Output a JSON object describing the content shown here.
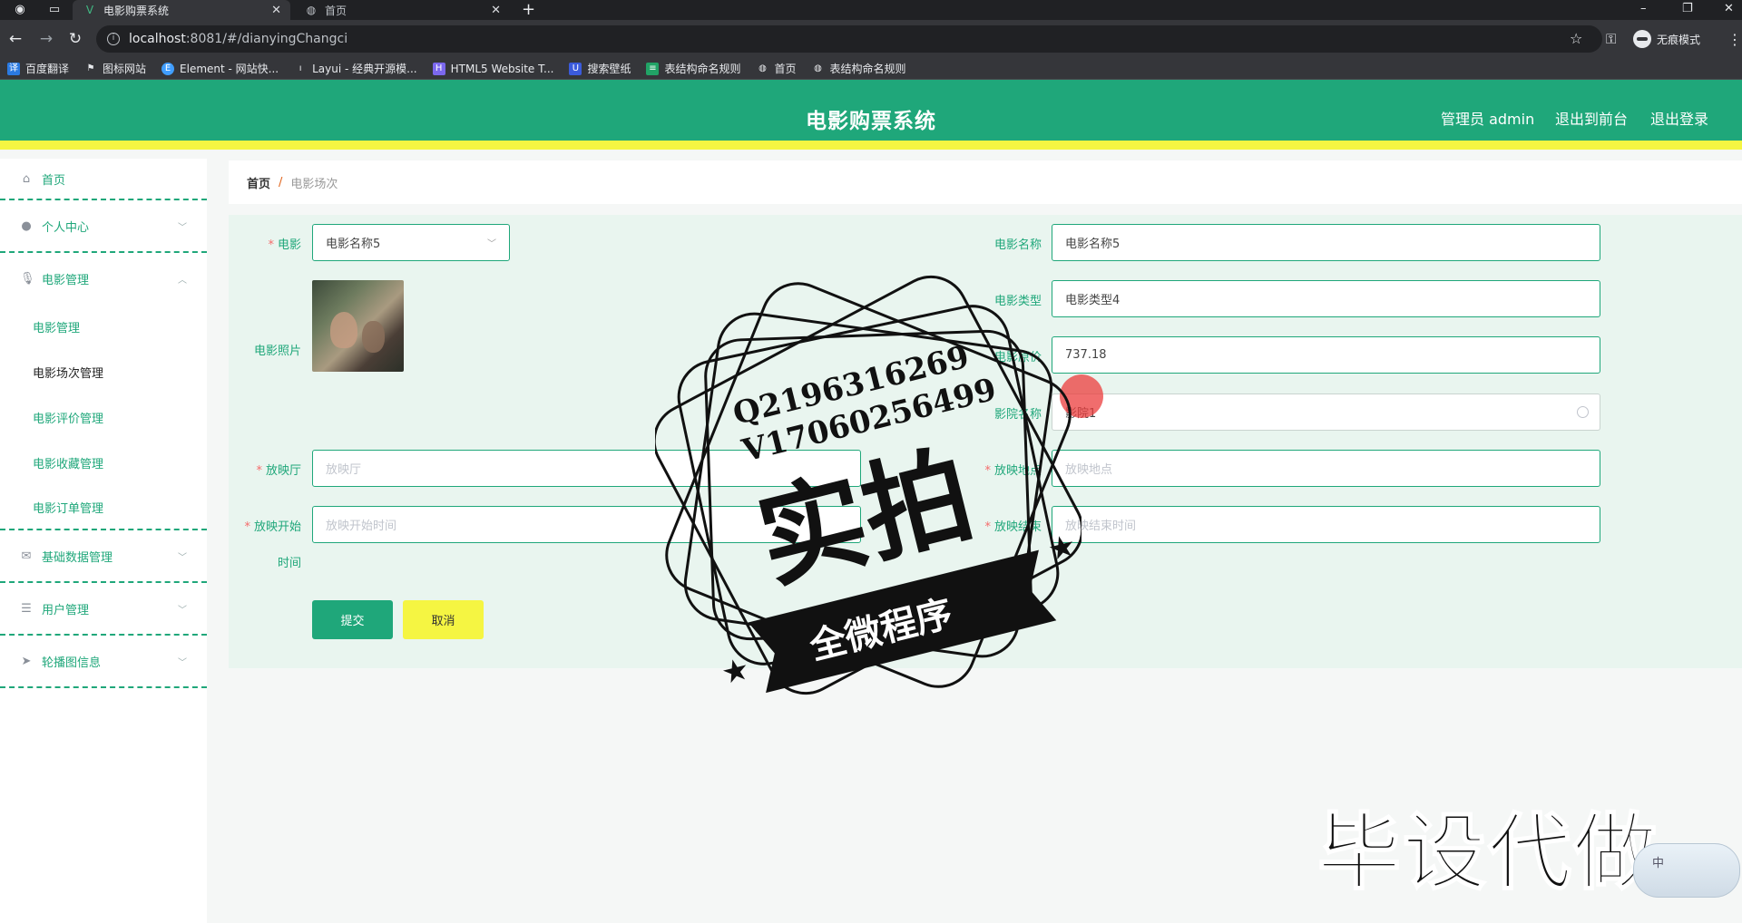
{
  "browser": {
    "active_tab_title": "电影购票系统",
    "inactive_tab_title": "首页",
    "url_host": "localhost",
    "url_rest": ":8081/#/dianyingChangci",
    "incognito_label": "无痕模式",
    "bookmarks": [
      "百度翻译",
      "图标网站",
      "Element - 网站快...",
      "Layui - 经典开源模...",
      "HTML5 Website T...",
      "搜索壁纸",
      "表结构命名规则",
      "首页",
      "表结构命名规则"
    ]
  },
  "header": {
    "title": "电影购票系统",
    "admin_label": "管理员 admin",
    "back_to_front": "退出到前台",
    "logout": "退出登录"
  },
  "sidebar": {
    "items": [
      {
        "label": "首页",
        "icon": "home-icon"
      },
      {
        "label": "个人中心",
        "icon": "user-icon"
      },
      {
        "label": "电影管理",
        "icon": "mic-icon"
      },
      {
        "label": "基础数据管理",
        "icon": "mail-icon"
      },
      {
        "label": "用户管理",
        "icon": "list-icon"
      },
      {
        "label": "轮播图信息",
        "icon": "send-icon"
      }
    ],
    "submenu": [
      "电影管理",
      "电影场次管理",
      "电影评价管理",
      "电影收藏管理",
      "电影订单管理"
    ]
  },
  "breadcrumb": {
    "home": "首页",
    "current": "电影场次"
  },
  "form": {
    "movie_label": "电影",
    "movie_select_value": "电影名称5",
    "photo_label": "电影照片",
    "hall_label": "放映厅",
    "hall_placeholder": "放映厅",
    "start_label": "放映开始",
    "start_label_2": "时间",
    "start_placeholder": "放映开始时间",
    "movie_name_label": "电影名称",
    "movie_name_value": "电影名称5",
    "movie_type_label": "电影类型",
    "movie_type_value": "电影类型4",
    "movie_price_label": "电影原价",
    "movie_price_value": "737.18",
    "cinema_label": "影院名称",
    "cinema_value": "影院1",
    "location_label": "放映地点",
    "location_placeholder": "放映地点",
    "end_label": "放映结束",
    "end_placeholder": "放映结束时间",
    "submit": "提交",
    "cancel": "取消"
  },
  "watermark": {
    "qq": "Q2196316269",
    "vx": "V17060256499",
    "main": "实拍",
    "ribbon": "全微程序",
    "bottom": "毕设代做",
    "ime": "中"
  },
  "colors": {
    "primary": "#1fa77a",
    "accent_yellow": "#f5f542",
    "required": "#f56c6c"
  }
}
